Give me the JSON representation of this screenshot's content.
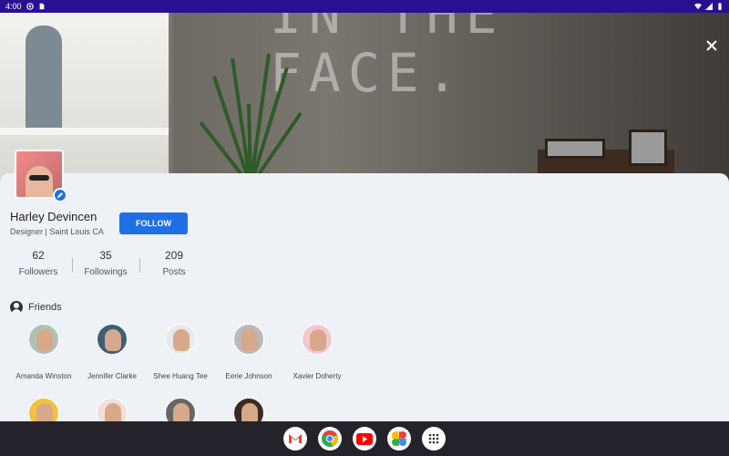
{
  "status_bar": {
    "time": "4:00"
  },
  "cover": {
    "wall_text_line1": "IN THE",
    "wall_text_line2": "FACE."
  },
  "profile": {
    "name": "Harley Devincen",
    "role": "Designer | Saint Louis CA",
    "follow_label": "FOLLOW",
    "stats": [
      {
        "value": "62",
        "label": "Followers"
      },
      {
        "value": "35",
        "label": "Followings"
      },
      {
        "value": "209",
        "label": "Posts"
      }
    ]
  },
  "friends": {
    "title": "Friends",
    "items": [
      {
        "name": "Amanda Winston"
      },
      {
        "name": "Jennifer Clarke"
      },
      {
        "name": "Shee Huang Tee"
      },
      {
        "name": "Eerie Johnson"
      },
      {
        "name": "Xavier Doherty"
      },
      {
        "name": ""
      },
      {
        "name": ""
      },
      {
        "name": ""
      },
      {
        "name": ""
      }
    ]
  },
  "taskbar": {
    "apps": [
      "gmail-icon",
      "chrome-icon",
      "youtube-icon",
      "photos-icon",
      "app-drawer-icon"
    ]
  },
  "colors": {
    "status_bar": "#2b0f93",
    "accent": "#1f6fe5",
    "sheet": "#eef2f6",
    "taskbar": "#24232b"
  }
}
